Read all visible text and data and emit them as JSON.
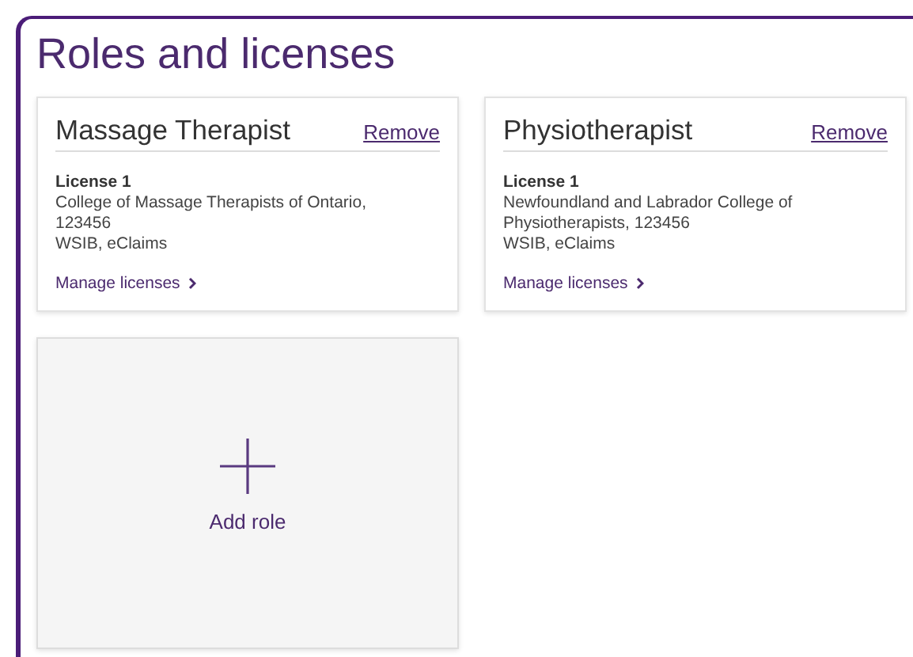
{
  "title": "Roles and licenses",
  "roles": [
    {
      "title": "Massage Therapist",
      "remove": "Remove",
      "license_label": "License 1",
      "details": [
        "College of Massage Therapists of Ontario, 123456",
        "WSIB, eClaims"
      ],
      "manage": "Manage licenses"
    },
    {
      "title": "Physiotherapist",
      "remove": "Remove",
      "license_label": "License 1",
      "details": [
        "Newfoundland and Labrador College of Physiotherapists, 123456",
        "WSIB, eClaims"
      ],
      "manage": "Manage licenses"
    }
  ],
  "add_role": {
    "label": "Add role"
  }
}
